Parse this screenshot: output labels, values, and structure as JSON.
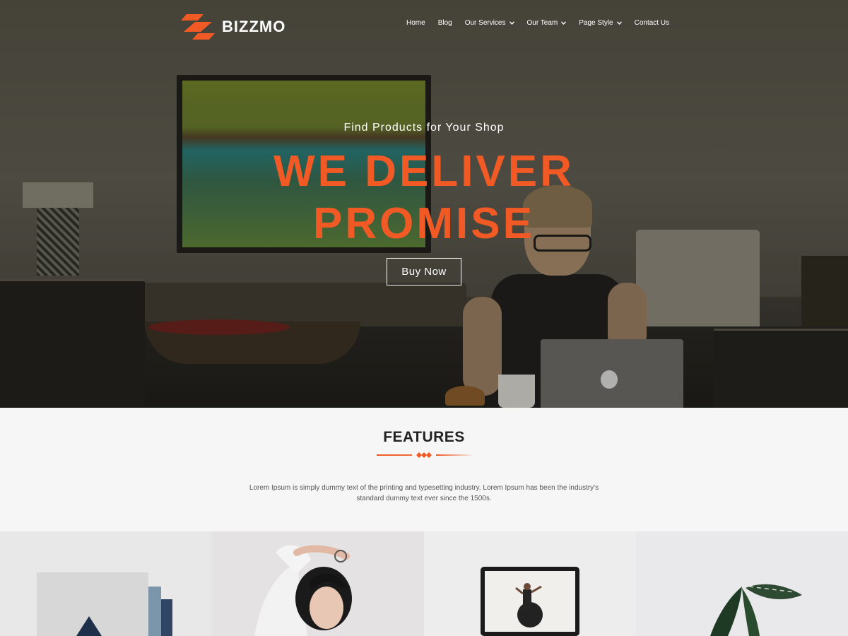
{
  "brand": {
    "name": "BIZZMO",
    "accent": "#f15a24"
  },
  "nav": {
    "items": [
      {
        "label": "Home",
        "has_dropdown": false
      },
      {
        "label": "Blog",
        "has_dropdown": false
      },
      {
        "label": "Our Services",
        "has_dropdown": true
      },
      {
        "label": "Our Team",
        "has_dropdown": true
      },
      {
        "label": "Page Style",
        "has_dropdown": true
      },
      {
        "label": "Contact Us",
        "has_dropdown": false
      }
    ]
  },
  "hero": {
    "subtitle": "Find Products for Your Shop",
    "title_line1": "WE DELIVER",
    "title_line2": "PROMISE",
    "button_label": "Buy Now"
  },
  "features": {
    "title": "FEATURES",
    "text": "Lorem Ipsum is simply dummy text of the printing and typesetting industry. Lorem Ipsum has been the industry's standard dummy text ever since the 1500s."
  }
}
